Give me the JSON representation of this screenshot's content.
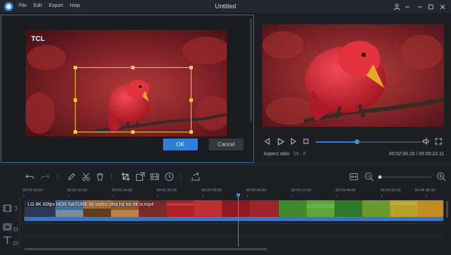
{
  "window": {
    "title": "Untitled"
  },
  "menu": [
    "File",
    "Edit",
    "Export",
    "Help"
  ],
  "crop_dialog": {
    "ok_label": "OK",
    "cancel_label": "Cancel",
    "watermark": "TCL"
  },
  "preview": {
    "aspect_ratio_label": "Aspect ratio",
    "aspect_ratio_value": "16 : 9",
    "timecode": "00:02:30.18 / 00:06:22.11",
    "progress_fraction": 0.39
  },
  "timeline": {
    "ruler_labels": [
      "00:00:00.00",
      "00:00:32.00",
      "00:01:04.00",
      "00:01:36.00",
      "00:02:08.00",
      "00:02:40.00",
      "00:03:12.00",
      "00:03:44.00",
      "00:04:16.00",
      "00:04:48.00"
    ],
    "clip_name": "LG 8K 60fps HDR NATURE 8k video ultra hd for 8k tv.mp4"
  },
  "icons": {
    "toolbar_left": [
      "undo-icon",
      "redo-icon",
      "pen-icon",
      "scissors-icon",
      "trash-icon",
      "crop-icon",
      "resize-icon",
      "film-icon",
      "clock-icon",
      "export-icon"
    ],
    "toolbar_right": [
      "fit-icon",
      "zoom-out-icon",
      "zoom-in-icon"
    ]
  },
  "colors": {
    "accent": "#2d7fd7",
    "crop_frame": "#f0d030",
    "clip_band": "#3a74c4"
  }
}
